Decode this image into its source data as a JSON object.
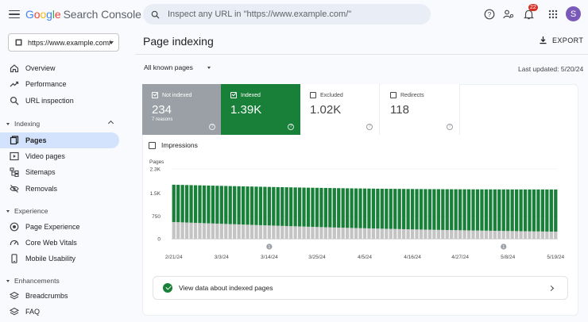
{
  "header": {
    "logo_letters": [
      "G",
      "o",
      "o",
      "g",
      "l",
      "e"
    ],
    "product": "Search Console",
    "search_placeholder": "Inspect any URL in \"https://www.example.com/\"",
    "notification_count": "22",
    "avatar_initial": "S"
  },
  "sidebar": {
    "property": "https://www.example.com/",
    "top_items": [
      {
        "label": "Overview",
        "icon": "home-icon"
      },
      {
        "label": "Performance",
        "icon": "trending-up-icon"
      },
      {
        "label": "URL inspection",
        "icon": "search-icon"
      }
    ],
    "sections": [
      {
        "label": "Indexing",
        "items": [
          "Pages",
          "Video pages",
          "Sitemaps",
          "Removals"
        ]
      },
      {
        "label": "Experience",
        "items": [
          "Page Experience",
          "Core Web Vitals",
          "Mobile Usability"
        ]
      },
      {
        "label": "Enhancements",
        "items": [
          "Breadcrumbs",
          "FAQ"
        ]
      }
    ],
    "active_item": "Pages"
  },
  "main": {
    "title": "Page indexing",
    "export_label": "EXPORT",
    "filter_label": "All known pages",
    "last_updated": "Last updated: 5/20/24",
    "tiles": [
      {
        "label": "Not indexed",
        "value": "234",
        "sub": "7 reasons",
        "checked": true,
        "color": "#9aa0a6"
      },
      {
        "label": "Indexed",
        "value": "1.39K",
        "sub": "",
        "checked": true,
        "color": "#188038"
      },
      {
        "label": "Excluded",
        "value": "1.02K",
        "sub": "",
        "checked": false,
        "color": "#ffffff"
      },
      {
        "label": "Redirects",
        "value": "118",
        "sub": "",
        "checked": false,
        "color": "#ffffff"
      }
    ],
    "impressions_label": "Impressions",
    "view_data_label": "View data about indexed pages"
  },
  "chart_data": {
    "type": "bar",
    "ylabel": "Pages",
    "ytick_labels": [
      "2.3K",
      "1.5K",
      "750",
      "0"
    ],
    "yticks": [
      2300,
      1500,
      750,
      0
    ],
    "ylim": [
      0,
      2300
    ],
    "xtick_labels": [
      "2/21/24",
      "3/3/24",
      "3/14/24",
      "3/25/24",
      "4/5/24",
      "4/16/24",
      "4/27/24",
      "5/8/24",
      "5/19/24"
    ],
    "start_date": "2024-02-21",
    "end_date": "2024-05-19",
    "annotation_markers": [
      {
        "date": "2024-03-14",
        "label": "1"
      },
      {
        "date": "2024-05-07",
        "label": "1"
      }
    ],
    "series": [
      {
        "name": "Not indexed",
        "color": "#c4c4c4",
        "start": 550,
        "end": 234
      },
      {
        "name": "Indexed",
        "color": "#188038",
        "start": 1230,
        "end": 1390
      }
    ]
  }
}
